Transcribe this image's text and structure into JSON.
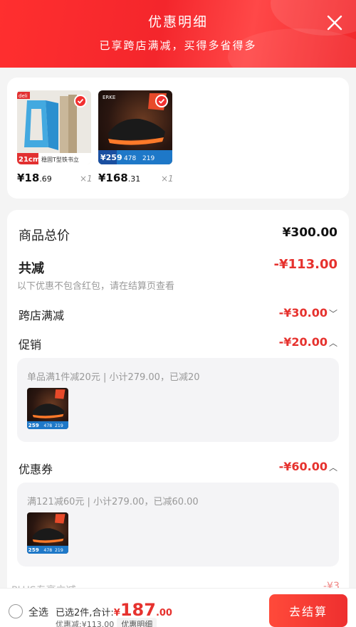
{
  "header": {
    "title": "优惠明细",
    "subtitle": "已享跨店满减，买得多省得多"
  },
  "products": [
    {
      "image": "desk-bookend-stand",
      "brand": "deli",
      "badge_size": "21cm",
      "badge_label": "稳固T型铁书立",
      "price_main": "¥18",
      "price_cents": ".69",
      "qty": "×1",
      "checked": true
    },
    {
      "image": "running-shoe",
      "brand": "ERKE",
      "promo_tags": [
        "259",
        "478",
        "219"
      ],
      "price_main": "¥168",
      "price_cents": ".31",
      "qty": "×1",
      "checked": true
    }
  ],
  "summary": {
    "total_label": "商品总价",
    "total_value": "¥300.00",
    "reduce_label": "共减",
    "reduce_value": "-¥113.00",
    "reduce_note": "以下优惠不包含红包，请在结算页查看"
  },
  "rows": {
    "cross_store": {
      "label": "跨店满减",
      "value": "-¥30.00"
    },
    "promo": {
      "label": "促销",
      "value": "-¥20.00",
      "desc": "单品满1件减20元 | 小计279.00，已减20"
    },
    "coupon": {
      "label": "优惠券",
      "value": "-¥60.00",
      "desc": "满121减60元 | 小计279.00，已减60.00"
    },
    "plus": {
      "label": "PLUS专享立减",
      "value": "-¥3"
    }
  },
  "bottom": {
    "select_all": "全选",
    "selected_text": "已选2件,合计:",
    "amount_symbol": "¥",
    "amount_main": "187",
    "amount_cents": ".00",
    "discount_text": "优惠减:¥113.00",
    "discount_detail": "优惠明细",
    "checkout": "去结算"
  },
  "colors": {
    "accent": "#e6322e",
    "header": "#f4262c"
  }
}
